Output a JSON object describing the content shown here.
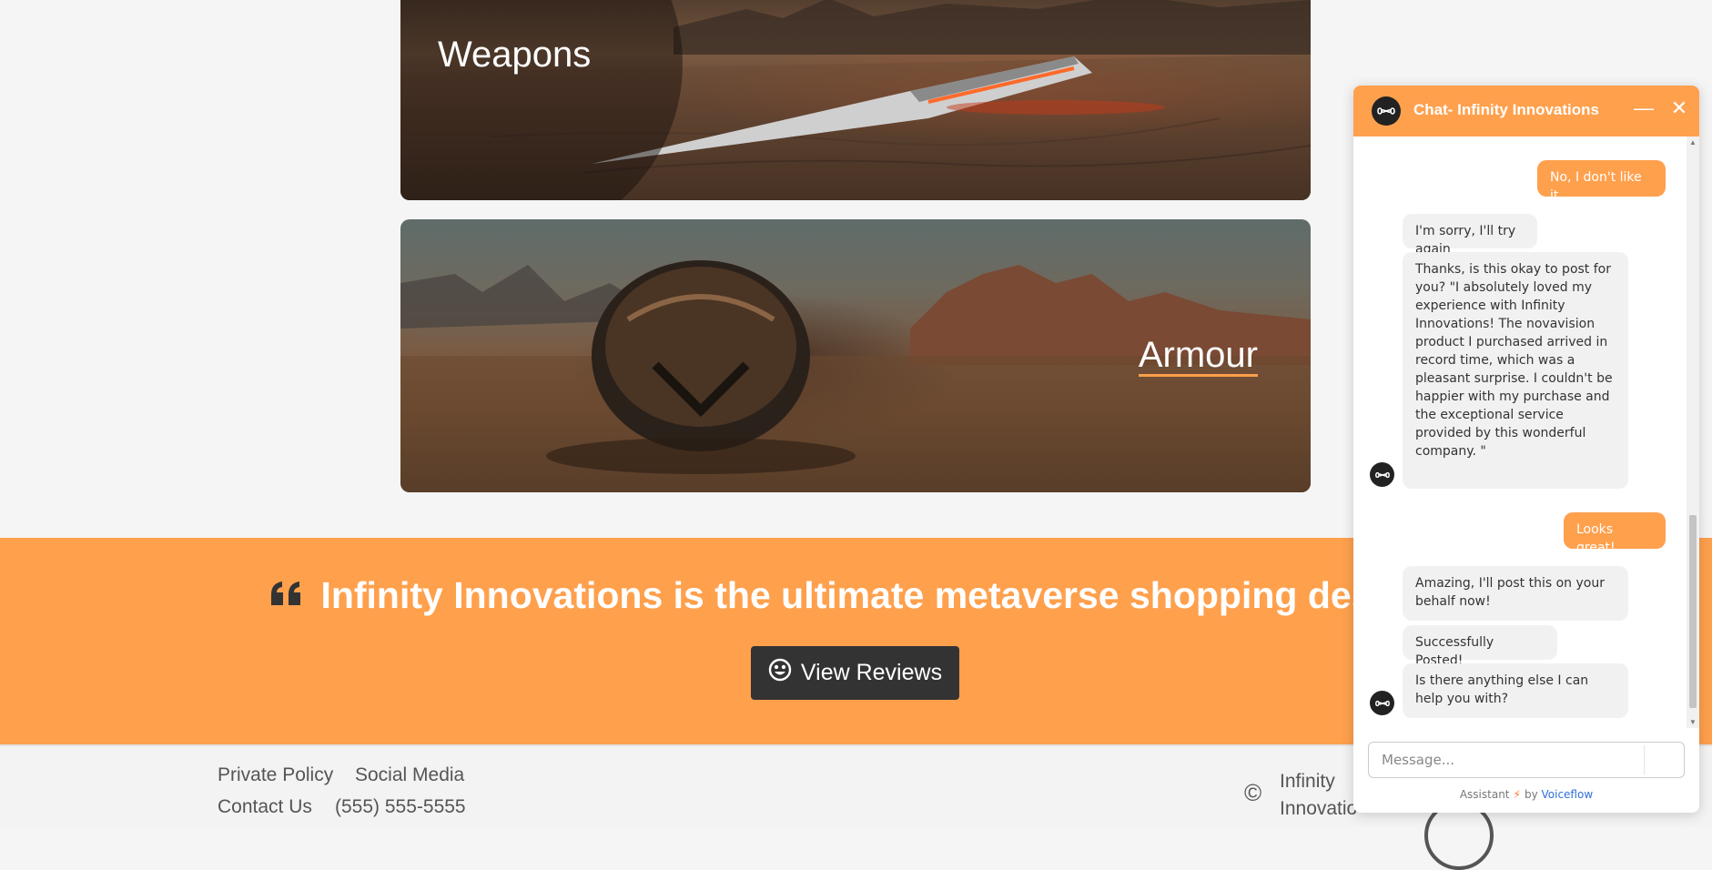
{
  "categories": [
    {
      "title": "Weapons"
    },
    {
      "title": "Armour"
    }
  ],
  "testimonial": {
    "quote_icon": "quote-left-icon",
    "text": "Infinity Innovations is the ultimate metaverse shopping destinatio",
    "button_label": "View Reviews",
    "button_icon": "smiley-icon"
  },
  "footer": {
    "links": [
      "Private Policy",
      "Social Media",
      "Contact Us",
      "(555) 555-5555"
    ],
    "copyright_line1": "Infinity",
    "copyright_line2": "Innovatio"
  },
  "chat": {
    "title": "Chat- Infinity Innovations",
    "minimize_icon": "minimize-icon",
    "close_icon": "close-icon",
    "messages": [
      {
        "from": "user",
        "text": "No, I don't like it"
      },
      {
        "from": "bot",
        "text": "I'm sorry, I'll try again"
      },
      {
        "from": "bot",
        "text": "Thanks, is this okay to post for you? \"I absolutely loved my experience with Infinity Innovations! The novavision product I purchased arrived in record time, which was a pleasant surprise. I couldn't be happier with my purchase and the exceptional service provided by this wonderful company. \""
      },
      {
        "from": "user",
        "text": "Looks great!"
      },
      {
        "from": "bot",
        "text": "Amazing, I'll post this on your behalf now!"
      },
      {
        "from": "bot",
        "text": "Successfully Posted!"
      },
      {
        "from": "bot",
        "text": "Is there anything else I can help you with?"
      }
    ],
    "input_placeholder": "Message...",
    "powered_prefix": "Assistant",
    "powered_by": "by",
    "powered_brand": "Voiceflow"
  },
  "colors": {
    "accent": "#ffa04d",
    "dark": "#333333",
    "page": "#f5f5f5"
  }
}
